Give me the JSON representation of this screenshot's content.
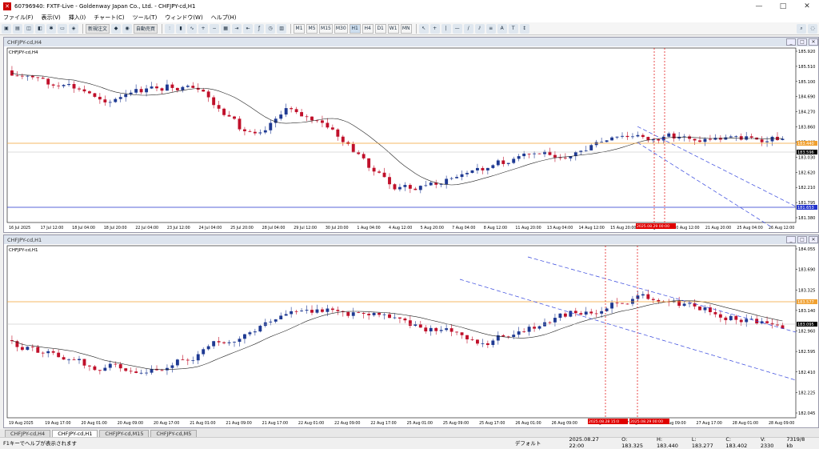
{
  "window": {
    "title": "60796940: FXTF-Live - Goldenway Japan Co., Ltd. - CHFJPY-cd,H1",
    "controls": [
      "—",
      "□",
      "✕"
    ]
  },
  "menu": [
    "ファイル(F)",
    "表示(V)",
    "挿入(I)",
    "チャート(C)",
    "ツール(T)",
    "ウィンドウ(W)",
    "ヘルプ(H)"
  ],
  "toolbar": {
    "new_order": "新規注文",
    "auto_trade": "自動売買",
    "timeframes": [
      "M1",
      "M5",
      "M15",
      "M30",
      "H1",
      "H4",
      "D1",
      "W1",
      "MN"
    ],
    "active_timeframe": "H1"
  },
  "chart_h4": {
    "window_title": "CHFJPY-cd,H4",
    "symbol_label": "CHFJPY-cd,H4",
    "price_ticks": [
      "185.920",
      "185.510",
      "185.100",
      "184.690",
      "184.270",
      "183.860",
      "183.440",
      "183.030",
      "182.620",
      "182.210",
      "181.795",
      "181.380"
    ],
    "current_price": "183.596",
    "orange_level": "183.440",
    "blue_level": "181.653",
    "time_ticks": [
      "16 Jul 2025",
      "17 Jul 12:00",
      "18 Jul 04:00",
      "18 Jul 20:00",
      "22 Jul 04:00",
      "23 Jul 12:00",
      "24 Jul 04:00",
      "25 Jul 20:00",
      "28 Jul 04:00",
      "29 Jul 12:00",
      "30 Jul 20:00",
      "1 Aug 04:00",
      "4 Aug 12:00",
      "5 Aug 20:00",
      "7 Aug 04:00",
      "8 Aug 12:00",
      "11 Aug 20:00",
      "13 Aug 04:00",
      "14 Aug 12:00",
      "15 Aug 20:00",
      "19 Aug 04:00",
      "20 Aug 12:00",
      "21 Aug 20:00",
      "25 Aug 04:00",
      "26 Aug 12:00"
    ],
    "vline_label": "2025.08.29 00:00"
  },
  "chart_h1": {
    "window_title": "CHFJPY-cd,H1",
    "symbol_label": "CHFJPY-cd,H1",
    "price_ticks": [
      "184.055",
      "183.690",
      "183.325",
      "183.140",
      "182.960",
      "182.595",
      "182.410",
      "182.225",
      "182.045"
    ],
    "current_price": "183.095",
    "orange_level": "183.577",
    "time_ticks": [
      "19 Aug 2025",
      "19 Aug 17:00",
      "20 Aug 01:00",
      "20 Aug 09:00",
      "20 Aug 17:00",
      "21 Aug 01:00",
      "21 Aug 09:00",
      "21 Aug 17:00",
      "22 Aug 01:00",
      "22 Aug 09:00",
      "22 Aug 17:00",
      "25 Aug 01:00",
      "25 Aug 09:00",
      "25 Aug 17:00",
      "26 Aug 01:00",
      "26 Aug 09:00",
      "26 Aug 17:00",
      "27 Aug 01:00",
      "27 Aug 09:00",
      "27 Aug 17:00",
      "28 Aug 01:00",
      "28 Aug 09:00"
    ],
    "vline_label_1": "2025.08.28 15:0",
    "vline_label_2": "2025.08.29 00:00"
  },
  "tabs": [
    "CHFJPY-cd,H4",
    "CHFJPY-cd,H1",
    "CHFJPY-cd,M15",
    "CHFJPY-cd,M5"
  ],
  "active_tab": "CHFJPY-cd,H1",
  "status": {
    "help": "F1キーでヘルプが表示されます",
    "profile": "デフォルト",
    "datetime": "2025.08.27 22:00",
    "open": "O: 183.325",
    "high": "H: 183.440",
    "low": "L: 183.277",
    "close": "C: 183.402",
    "volume": "V: 2330",
    "conn": "7319/8 kb"
  },
  "colors": {
    "bull": "#1f3a93",
    "bear": "#c0102a",
    "ma": "#222222",
    "orange": "#f0a030",
    "blue_line": "#2233cc",
    "dashed_blue": "#3344dd",
    "red_marker": "#e00000"
  }
}
